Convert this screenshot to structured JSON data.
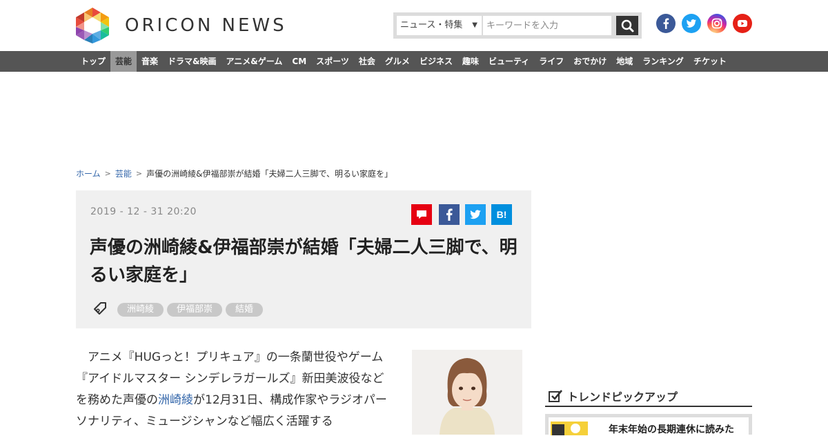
{
  "header": {
    "brand": "ORICON NEWS",
    "search": {
      "category": "ニュース・特集",
      "placeholder": "キーワードを入力"
    }
  },
  "nav": {
    "items": [
      "トップ",
      "芸能",
      "音楽",
      "ドラマ&映画",
      "アニメ&ゲーム",
      "CM",
      "スポーツ",
      "社会",
      "グルメ",
      "ビジネス",
      "趣味",
      "ビューティ",
      "ライフ",
      "おでかけ",
      "地域",
      "ランキング",
      "チケット"
    ],
    "active_index": 1
  },
  "breadcrumb": {
    "home": "ホーム",
    "category": "芸能",
    "current": "声優の洲崎綾&伊福部崇が結婚「夫婦二人三脚で、明るい家庭を」"
  },
  "article": {
    "date": "2019 - 12 - 31  20:20",
    "share_hatena": "B!",
    "title": "声優の洲崎綾&伊福部崇が結婚「夫婦二人三脚で、明るい家庭を」",
    "tags": [
      "洲崎綾",
      "伊福部崇",
      "結婚"
    ],
    "body_before": "　アニメ『HUGっと！プリキュア』の一条蘭世役やゲーム『アイドルマスター シンデレラガールズ』新田美波役などを務めた声優の",
    "body_link": "洲崎綾",
    "body_after": "が12月31日、構成作家やラジオパーソナリティ、ミュージシャンなど幅広く活躍する"
  },
  "sidebar": {
    "trend_title": "トレンドピックアップ",
    "trend_item": "年末年始の長期連休に読みた"
  },
  "colors": {
    "nav_bg": "#555555",
    "link": "#3366aa",
    "head_box": "#f0f0f0"
  }
}
